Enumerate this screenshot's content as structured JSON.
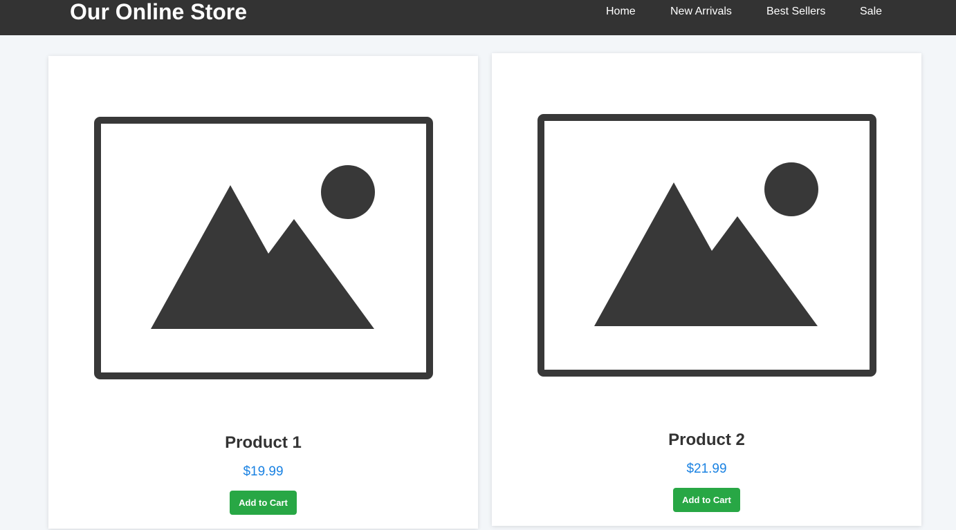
{
  "header": {
    "brand": "Our Online Store",
    "nav": [
      {
        "label": "Home"
      },
      {
        "label": "New Arrivals"
      },
      {
        "label": "Best Sellers"
      },
      {
        "label": "Sale"
      }
    ]
  },
  "products": [
    {
      "name": "Product 1",
      "price": "$19.99",
      "button_label": "Add to Cart",
      "image_icon": "image-placeholder-icon"
    },
    {
      "name": "Product 2",
      "price": "$21.99",
      "button_label": "Add to Cart",
      "image_icon": "image-placeholder-icon"
    }
  ],
  "colors": {
    "navbar_bg": "#333333",
    "page_bg": "#f3f6f9",
    "price": "#1a82e2",
    "button": "#28a745",
    "icon": "#383838"
  }
}
